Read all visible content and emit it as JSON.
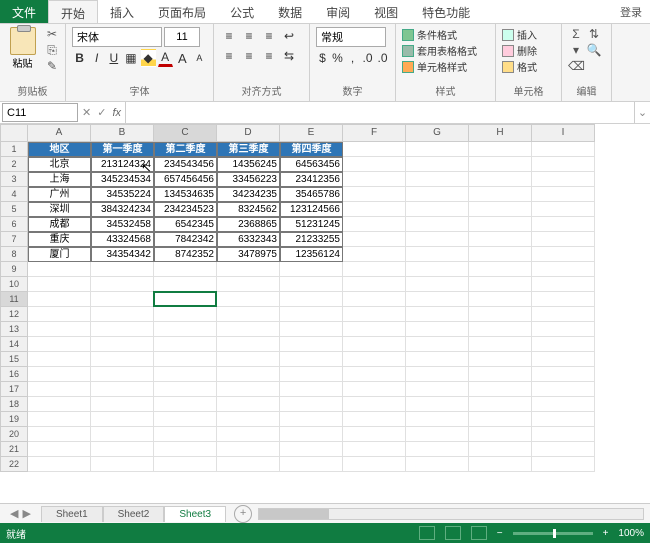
{
  "tabs": {
    "file": "文件",
    "items": [
      "开始",
      "插入",
      "页面布局",
      "公式",
      "数据",
      "审阅",
      "视图",
      "特色功能"
    ],
    "active_index": 0,
    "login": "登录"
  },
  "ribbon": {
    "clipboard": {
      "label": "剪贴板",
      "paste": "粘贴"
    },
    "font": {
      "label": "字体",
      "name": "宋体",
      "size": "11",
      "grow_tip": "A",
      "shrink_tip": "A"
    },
    "alignment": {
      "label": "对齐方式"
    },
    "number": {
      "label": "数字",
      "format": "常规"
    },
    "styles": {
      "label": "样式",
      "conditional": "条件格式",
      "table": "套用表格格式",
      "cell": "单元格样式"
    },
    "cells": {
      "label": "单元格",
      "insert": "插入",
      "delete": "删除",
      "format": "格式"
    },
    "editing": {
      "label": "编辑"
    }
  },
  "name_box": "C11",
  "formula": "",
  "columns": [
    "A",
    "B",
    "C",
    "D",
    "E",
    "F",
    "G",
    "H",
    "I"
  ],
  "row_count": 22,
  "active_cell": {
    "row": 11,
    "col": "C"
  },
  "chart_data": {
    "type": "table",
    "headers": [
      "地区",
      "第一季度",
      "第二季度",
      "第三季度",
      "第四季度"
    ],
    "rows": [
      [
        "北京",
        "213124324",
        "234543456",
        "14356245",
        "64563456"
      ],
      [
        "上海",
        "345234534",
        "657456456",
        "33456223",
        "23412356"
      ],
      [
        "广州",
        "34535224",
        "134534635",
        "34234235",
        "35465786"
      ],
      [
        "深圳",
        "384324234",
        "234234523",
        "8324562",
        "123124566"
      ],
      [
        "成都",
        "34532458",
        "6542345",
        "2368865",
        "51231245"
      ],
      [
        "重庆",
        "43324568",
        "7842342",
        "6332343",
        "21233255"
      ],
      [
        "厦门",
        "34354342",
        "8742352",
        "3478975",
        "12356124"
      ]
    ]
  },
  "sheets": {
    "items": [
      "Sheet1",
      "Sheet2",
      "Sheet3"
    ],
    "active_index": 2
  },
  "status": {
    "ready": "就绪",
    "zoom": "100%"
  }
}
